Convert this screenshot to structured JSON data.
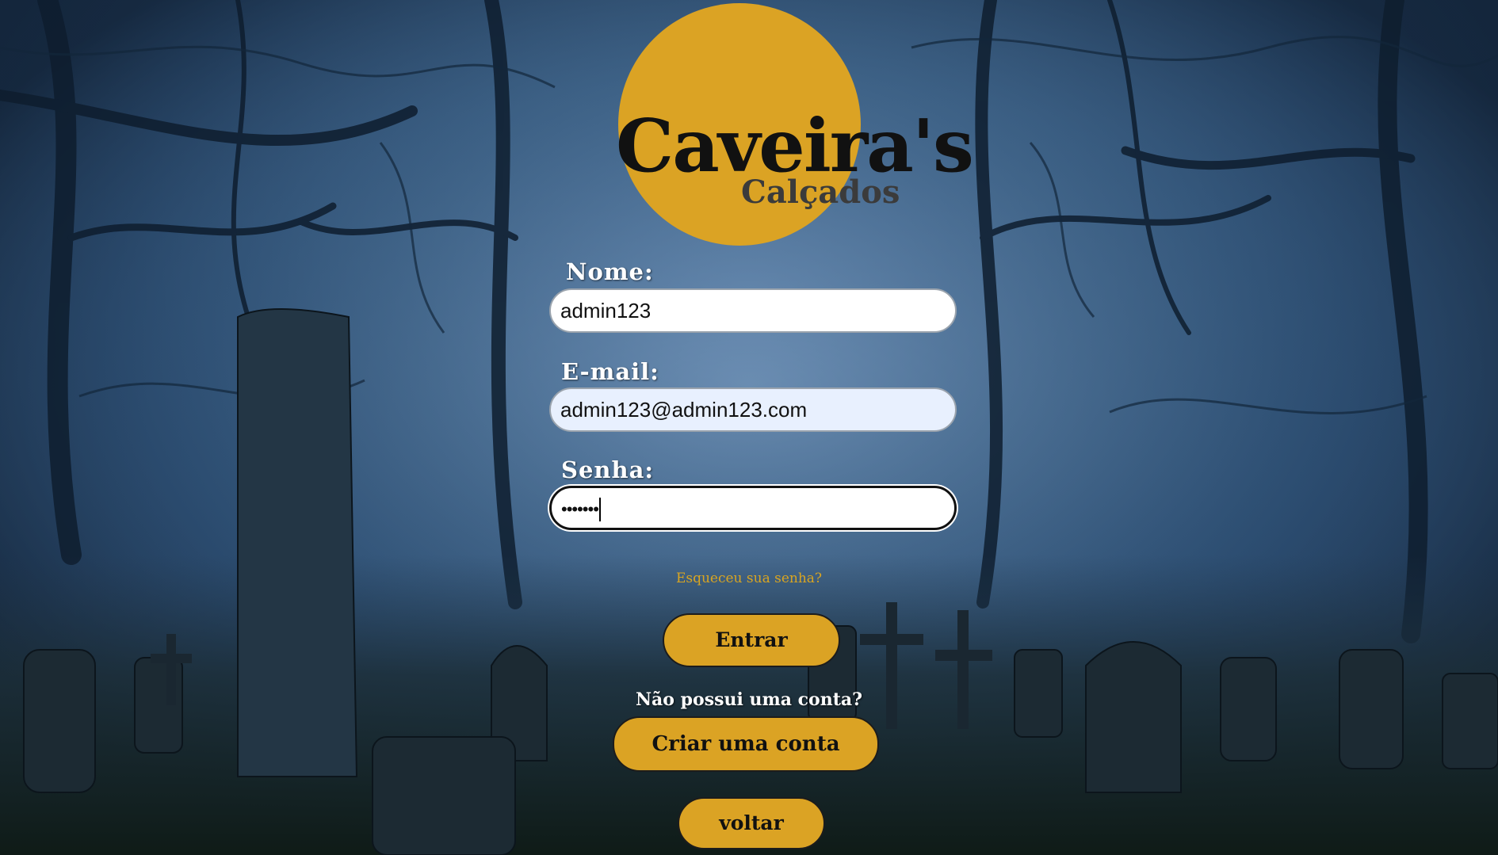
{
  "brand": {
    "name_main": "Caveira's",
    "name_sub": "Calçados",
    "logo_color": "#DBA324"
  },
  "form": {
    "name_label": "Nome:",
    "name_value": "admin123",
    "email_label": "E-mail:",
    "email_value": "admin123@admin123.com",
    "password_label": "Senha:",
    "password_value": "•••••••"
  },
  "links": {
    "forgot_password": "Esqueceu sua senha?"
  },
  "buttons": {
    "login": "Entrar",
    "create_account": "Criar uma conta",
    "back": "voltar"
  },
  "texts": {
    "no_account": "Não possui uma conta?"
  },
  "colors": {
    "accent": "#DBA324",
    "autofill": "#E8F0FE"
  }
}
